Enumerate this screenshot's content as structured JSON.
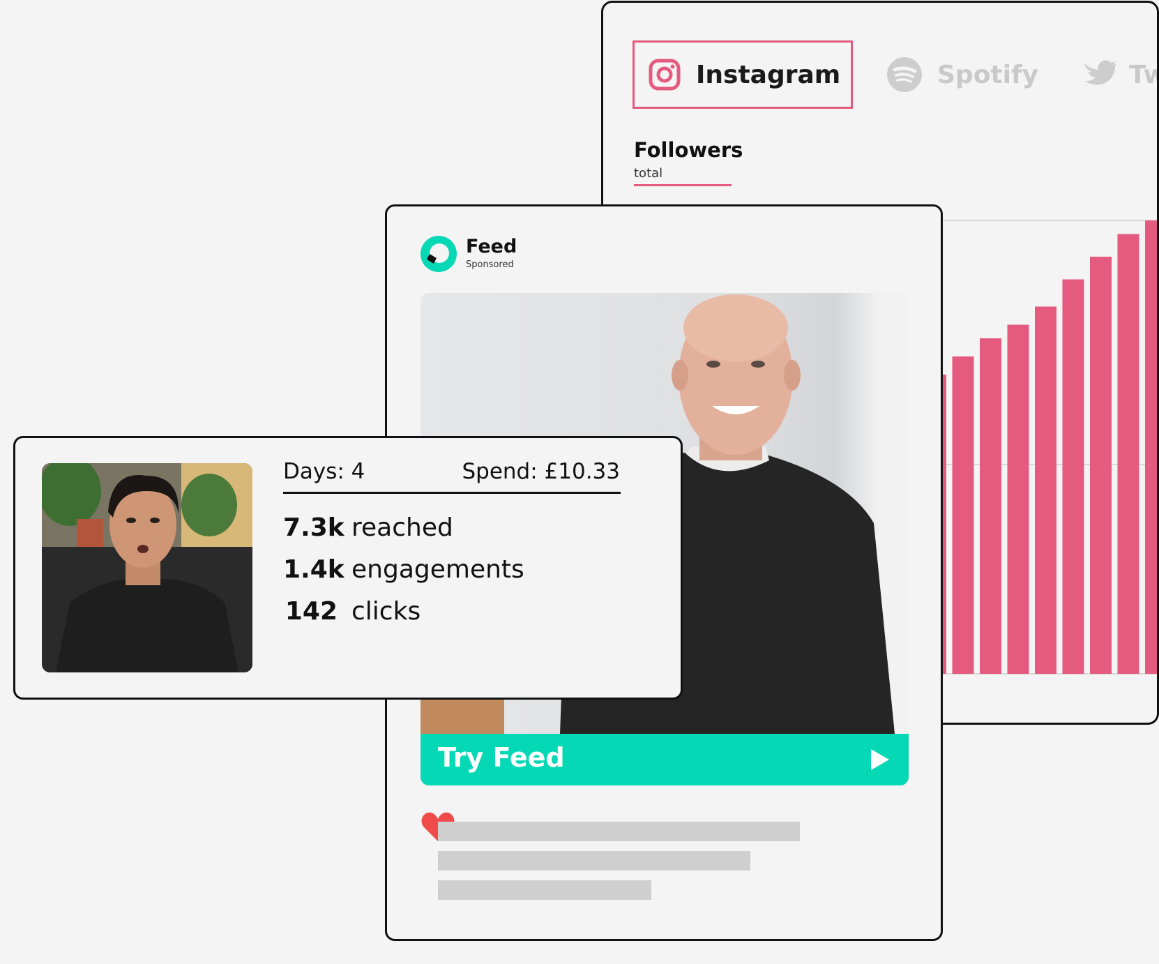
{
  "analytics": {
    "tabs": [
      {
        "label": "Instagram",
        "icon": "instagram-icon",
        "active": true
      },
      {
        "label": "Spotify",
        "icon": "spotify-icon",
        "active": false
      },
      {
        "label": "Tw",
        "icon": "twitter-icon",
        "active": false
      }
    ],
    "metric": {
      "title": "Followers",
      "subtitle": "total"
    },
    "colors": {
      "accent": "#e55a7f",
      "inactive": "#c9c9c9"
    }
  },
  "chart_data": {
    "type": "bar",
    "title": "",
    "xlabel": "",
    "ylabel": "",
    "grid": true,
    "values": [
      0.66,
      0.7,
      0.74,
      0.77,
      0.81,
      0.87,
      0.92,
      0.97,
      1.0
    ],
    "colors": {
      "bar": "#e55a7f"
    }
  },
  "feed": {
    "brand_name": "Feed",
    "brand_sub": "Sponsored",
    "cta_label": "Try Feed",
    "colors": {
      "cta": "#05d8b5",
      "heart": "#ef4b4b"
    }
  },
  "stats": {
    "days": "Days: 4",
    "spend": "Spend: £10.33",
    "rows": [
      {
        "value": "7.3k",
        "label": "reached"
      },
      {
        "value": "1.4k",
        "label": "engagements"
      },
      {
        "value": "142",
        "label": "clicks"
      }
    ]
  }
}
